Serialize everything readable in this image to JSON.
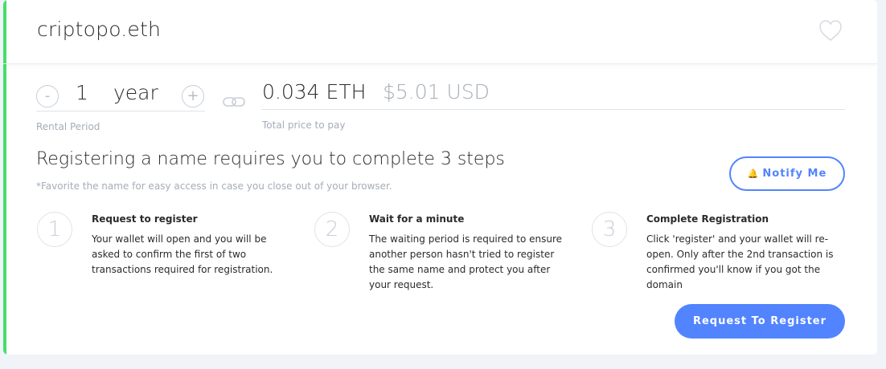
{
  "header": {
    "domain_name": "criptopo.eth",
    "favorite_icon": "heart-outline-icon"
  },
  "rental": {
    "decrement_label": "-",
    "increment_label": "+",
    "value": "1",
    "unit": "year",
    "label": "Rental Period"
  },
  "link_icon": "chain-link-icon",
  "price": {
    "eth": "0.034 ETH",
    "usd": "$5.01 USD",
    "label": "Total price to pay"
  },
  "steps_section": {
    "title": "Registering a name requires you to complete 3 steps",
    "note": "*Favorite the name for easy access in case you close out of your browser.",
    "notify_label": "Notify Me",
    "notify_icon": "bell-icon",
    "steps": [
      {
        "number": "1",
        "title": "Request to register",
        "body": "Your wallet will open and you will be asked to confirm the first of two transactions required for registration."
      },
      {
        "number": "2",
        "title": "Wait for a minute",
        "body": "The waiting period is required to ensure another person hasn't tried to register the same name and protect you after your request."
      },
      {
        "number": "3",
        "title": "Complete Registration",
        "body": "Click 'register' and your wallet will re-open. Only after the 2nd transaction is confirmed you'll know if you got the domain"
      }
    ]
  },
  "register_button_label": "Request To Register",
  "colors": {
    "accent_green": "#42e068",
    "primary_blue": "#5284ff",
    "muted_text": "#a5adb8",
    "page_background": "#f0f4f9"
  }
}
